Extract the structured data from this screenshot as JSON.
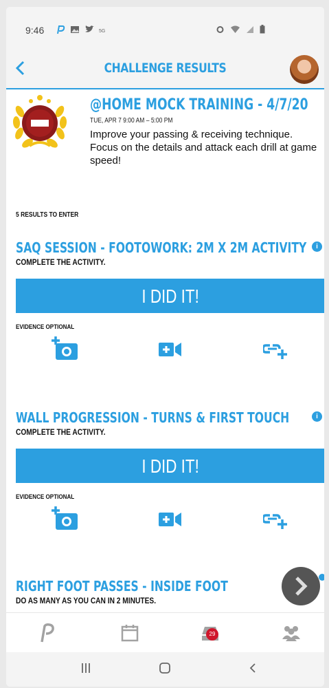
{
  "status_bar": {
    "time": "9:46",
    "left_icons": [
      "p-logo-icon",
      "gallery-icon",
      "twitter-icon",
      "wifi-small-icon"
    ],
    "right_icons": [
      "alarm-icon",
      "wifi-icon",
      "signal-icon",
      "battery-icon"
    ]
  },
  "header": {
    "title": "CHALLENGE RESULTS",
    "back_icon": "chevron-left-icon",
    "avatar": "user-avatar"
  },
  "challenge": {
    "title": "@HOME MOCK TRAINING - 4/7/20",
    "date": "TUE, APR 7 9:00 AM – 5:00 PM",
    "description": "Improve your passing & receiving technique. Focus on the details and attack each drill at game speed!"
  },
  "results_count": "5 RESULTS TO ENTER",
  "activities": [
    {
      "title": "SAQ SESSION - FOOTOWORK: 2M X 2M ACTIVITY",
      "subtitle": "COMPLETE THE ACTIVITY.",
      "button": "I DID IT!",
      "evidence": "EVIDENCE OPTIONAL"
    },
    {
      "title": "WALL PROGRESSION - TURNS & FIRST TOUCH",
      "subtitle": "COMPLETE THE ACTIVITY.",
      "button": "I DID IT!",
      "evidence": "EVIDENCE OPTIONAL"
    },
    {
      "title": "RIGHT FOOT PASSES - INSIDE FOOT",
      "subtitle": "DO AS MANY AS YOU CAN IN 2 MINUTES."
    }
  ],
  "tabbar": {
    "badge_count": "29",
    "items": [
      "home-logo-icon",
      "calendar-icon",
      "inbox-icon",
      "team-icon"
    ]
  },
  "colors": {
    "accent": "#2c9fe0",
    "badge_red": "#d0162b",
    "gold": "#f2c21a"
  }
}
